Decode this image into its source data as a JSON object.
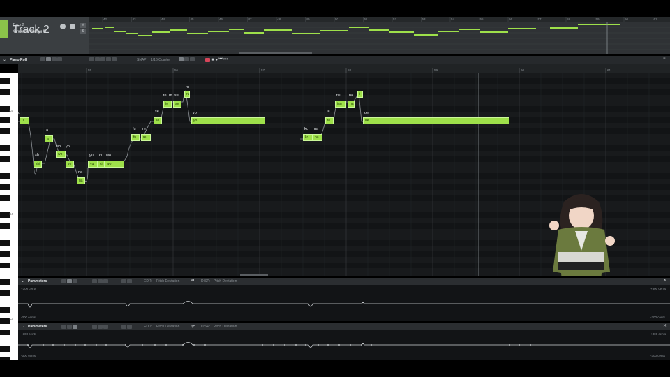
{
  "track": {
    "name": "Track 2",
    "singer": "Kanakama Chifuyu AI",
    "mute": "M",
    "solo": "S",
    "ruler_bars": [
      "42",
      "43",
      "44",
      "45",
      "46",
      "47",
      "48",
      "49",
      "50",
      "51",
      "52",
      "53",
      "54",
      "55",
      "56",
      "57",
      "58",
      "59",
      "60",
      "61"
    ]
  },
  "piano_roll": {
    "title": "Piano Roll",
    "snap_label": "SNAP",
    "snap_value": "1/16 Quarter",
    "ruler_bars": [
      "55",
      "56",
      "57",
      "58",
      "59",
      "60",
      "61"
    ],
    "key_labels": [
      "C5",
      "C4",
      "C3"
    ]
  },
  "notes": [
    {
      "lyric": "u",
      "text": "u"
    },
    {
      "lyric": "sh",
      "text": "shi"
    },
    {
      "lyric": "a",
      "text": "a"
    },
    {
      "lyric": "wo",
      "text": "wo"
    },
    {
      "lyric": "yo",
      "text": "yo"
    },
    {
      "lyric": "na",
      "text": "na"
    },
    {
      "lyric": "yu",
      "text": "yu"
    },
    {
      "lyric": "ki",
      "text": "ki"
    },
    {
      "lyric": "wo",
      "text": "wo"
    },
    {
      "lyric": "fu",
      "text": "fu"
    },
    {
      "lyric": "re",
      "text": "re"
    },
    {
      "lyric": "se",
      "text": "se"
    },
    {
      "lyric": "te",
      "text": "te"
    },
    {
      "lyric": "m",
      "text": "m"
    },
    {
      "lyric": "se",
      "text": "se"
    },
    {
      "lyric": "ru",
      "text": "ru"
    },
    {
      "lyric": "yo",
      "text": "yo"
    },
    {
      "lyric": "ko",
      "text": "ko"
    },
    {
      "lyric": "na",
      "text": "na"
    },
    {
      "lyric": "te",
      "text": "te"
    },
    {
      "lyric": "tsu",
      "text": "tsu"
    },
    {
      "lyric": "na",
      "text": "na"
    },
    {
      "lyric": "i",
      "text": "i"
    },
    {
      "lyric": "de",
      "text": "de"
    }
  ],
  "parameters": [
    {
      "title": "Parameters",
      "edit_label": "EDIT:",
      "edit_value": "Pitch Deviation",
      "disp_label": "DISP:",
      "disp_value": "Pitch Deviation",
      "top_range": "+300 cents",
      "bottom_range": "-300 cents"
    },
    {
      "title": "Parameters",
      "edit_label": "EDIT:",
      "edit_value": "Pitch Deviation",
      "disp_label": "DISP:",
      "disp_value": "Pitch Deviation",
      "top_range": "+300 cents",
      "bottom_range": "-300 cents"
    }
  ],
  "colors": {
    "note_fill": "#9ee04a",
    "track_accent": "#8bc34a",
    "record": "#d7455a"
  }
}
